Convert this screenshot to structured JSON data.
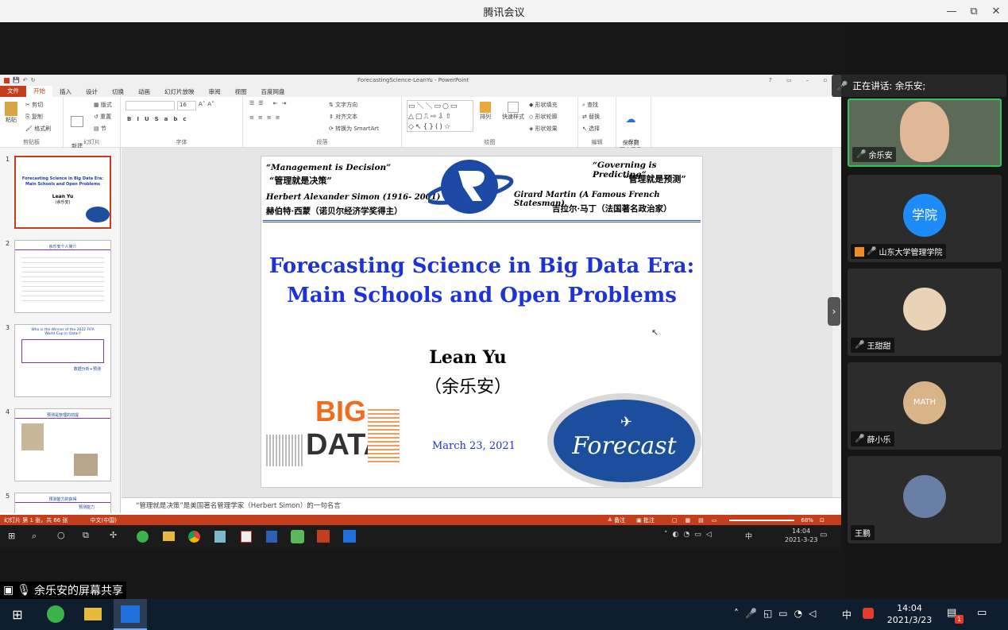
{
  "window": {
    "title": "腾讯会议",
    "min": "—",
    "max": "⧉",
    "close": "✕"
  },
  "ppt": {
    "title": "ForecastingScience-LeanYu - PowerPoint",
    "tabs": [
      "文件",
      "开始",
      "插入",
      "设计",
      "切换",
      "动画",
      "幻灯片放映",
      "审阅",
      "视图",
      "百度网盘"
    ],
    "groups": [
      "剪贴板",
      "幻灯片",
      "字体",
      "段落",
      "绘图",
      "编辑",
      "保存"
    ],
    "ribbon": {
      "paste": "粘贴",
      "cut": "剪切",
      "copy": "复制",
      "format_painter": "格式刷",
      "new_slide": "新建\n幻灯片",
      "layout": "版式",
      "reset": "重置",
      "section": "节",
      "font_size": "16",
      "text_dir": "文字方向",
      "align_text": "对齐文本",
      "smartart": "转换为 SmartArt",
      "arrange": "排列",
      "quick_styles": "快速样式",
      "shape_fill": "形状填充",
      "shape_outline": "形状轮廓",
      "shape_effects": "形状效果",
      "find": "查找",
      "replace": "替换",
      "select": "选择",
      "save_baidu": "保存到\n百度网盘"
    },
    "thumbs": [
      {
        "num": "1",
        "title": "Forecasting Science in Big Data Era: Main Schools and Open Problems",
        "sub": "Lean Yu",
        "sub2": "(余乐安)"
      },
      {
        "num": "2",
        "title": "余乐安个人简介"
      },
      {
        "num": "3",
        "title": "Who is the Winner of the 2022 FIFA World Cup in Qatar?",
        "sub": "数据分析+预测"
      },
      {
        "num": "4",
        "title": "预测是管理的前提"
      },
      {
        "num": "5",
        "title": "预测能力的获得",
        "sub": "预测能力"
      }
    ],
    "slide": {
      "quote_left_en": "“Management is Decision”",
      "quote_left_cn": "“管理就是决策”",
      "author_left_en": "Herbert Alexander Simon (1916- 2001)",
      "author_left_cn": "赫伯特·西蒙（诺贝尔经济学奖得主）",
      "quote_right_en": "“Governing is Predicting”",
      "quote_right_cn": "“管理就是预测”",
      "author_right_en": "Girard Martin (A Famous French Statesman)",
      "author_right_cn": "吉拉尔·马丁（法国著名政治家）",
      "title_line1": "Forecasting Science in Big Data Era:",
      "title_line2": "Main Schools and Open Problems",
      "author": "Lean Yu",
      "author_cn": "（余乐安）",
      "date": "March 23, 2021",
      "big": "BIG",
      "data": "DATA",
      "forecast": "Forecast"
    },
    "notes": "“管理就是决策”是美国著名管理学家（Herbert Simon）的一句名言",
    "status": {
      "slide_count": "幻灯片 第 1 张，共 66 张",
      "lang": "中文(中国)",
      "notes_btn": "备注",
      "comments_btn": "批注",
      "zoom": "68%"
    },
    "inner_clock": {
      "time": "14:04",
      "date": "2021-3-23",
      "ime": "中"
    }
  },
  "speaking": {
    "label": "正在讲话: 余乐安;"
  },
  "participants": [
    {
      "name": "余乐安",
      "avatar": ""
    },
    {
      "name": "山东大学管理学院",
      "avatar": "学院"
    },
    {
      "name": "王甜甜",
      "avatar": ""
    },
    {
      "name": "薛小乐",
      "avatar": "MATH"
    },
    {
      "name": "王鹏",
      "avatar": ""
    }
  ],
  "share_caption": "余乐安的屏幕共享",
  "taskbar": {
    "time": "14:04",
    "date": "2021/3/23",
    "ime": "中",
    "badge": "1"
  }
}
